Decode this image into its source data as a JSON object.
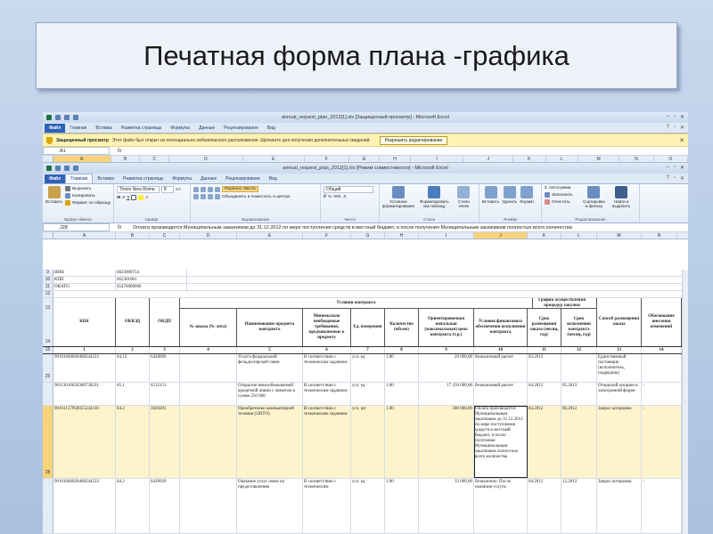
{
  "slide": {
    "title": "Печатная форма плана -графика"
  },
  "win1": {
    "title": "annual_request_plan_2012[1].xls [Защищенный просмотр] - Microsoft Excel",
    "tabs": [
      "Файл",
      "Главная",
      "Вставка",
      "Разметка страницы",
      "Формулы",
      "Данные",
      "Рецензирование",
      "Вид"
    ],
    "security": {
      "title": "Защищенный просмотр",
      "text": "Этот файл был открыт из потенциально небезопасного расположения. Щелкните для получения дополнительных сведений.",
      "button": "Разрешить редактирование"
    },
    "namebox": "A1",
    "columns": [
      "A",
      "B",
      "C",
      "D",
      "E",
      "F",
      "G",
      "H",
      "I",
      "J",
      "K",
      "L",
      "M",
      "N",
      "O"
    ]
  },
  "win2": {
    "title": "annual_request_plan_2012[1].xls [Режим совместимости] - Microsoft Excel",
    "tabs": [
      "Файл",
      "Главная",
      "Вставка",
      "Разметка страницы",
      "Формулы",
      "Данные",
      "Рецензирование",
      "Вид"
    ],
    "ribbon": {
      "paste": "Вставить",
      "cut": "Вырезать",
      "copy": "Копировать",
      "format_painter": "Формат по образцу",
      "clipboard_group": "Буфер обмена",
      "font_name": "Times New Roma",
      "font_size": "8",
      "font_group": "Шрифт",
      "wrap": "Перенос текста",
      "merge": "Объединить и поместить в центре",
      "align_group": "Выравнивание",
      "number_format": "Общий",
      "number_group": "Число",
      "cond_format": "Условное форматирование",
      "table_format": "Форматировать как таблицу",
      "cell_styles": "Стили ячеек",
      "styles_group": "Стили",
      "insert": "Вставить",
      "delete": "Удалить",
      "format": "Формат",
      "cells_group": "Ячейки",
      "autosum": "Автосумма",
      "fill": "Заполнить",
      "clear": "Очистить",
      "sort": "Сортировка и фильтр",
      "find": "Найти и выделить",
      "edit_group": "Редактирование"
    },
    "namebox": "J28",
    "formula": "Оплата производится Муниципальным заказчиком до 31.12.2012 по мере поступления средств в местный бюджет, и после получения Муниципальным заказчиком полностью всего количества",
    "columns": [
      "A",
      "B",
      "C",
      "D",
      "E",
      "F",
      "G",
      "H",
      "I",
      "J",
      "K",
      "L",
      "M",
      "N"
    ]
  },
  "info_rows": [
    {
      "rn": "9",
      "label": "ИНН",
      "value": "6623000754"
    },
    {
      "rn": "10",
      "label": "КПП",
      "value": "662301001"
    },
    {
      "rn": "11",
      "label": "ОКАТО",
      "value": "65476000000"
    }
  ],
  "header": {
    "contract_group": "Условия контракта",
    "schedule_group": "График осуществления процедур закупки",
    "kbk": "КБК",
    "okved": "ОКВЭД",
    "okdp": "ОКДП",
    "order_no": "№ заказа (№ лота)",
    "subject": "Наименование предмета контракта",
    "requirements": "Минимально необходимые требования, предъявляемые к предмету",
    "unit": "Ед. измерения",
    "quantity": "Количество (объем)",
    "price": "Ориентировочная начальная (максимальная) цена контракта (т.р.)",
    "payment": "Условия финансового обеспечения исполнения контракта",
    "placement_date": "Срок размещения заказа (месяц, год)",
    "exec_date": "Срок исполнения контракта (месяц, год)",
    "method": "Способ размещения заказа",
    "justification": "Обоснование внесения изменений",
    "rownums": {
      "r13": "13",
      "r14": "14",
      "r15": "15",
      "r12": "12"
    },
    "numbers": [
      "1",
      "2",
      "3",
      "4",
      "5",
      "6",
      "7",
      "8",
      "9",
      "10",
      "11",
      "12",
      "13",
      "14"
    ]
  },
  "data_rows": [
    {
      "rn": "26",
      "kbk": "90101040020400244223",
      "okved": "64.12",
      "okdp": "6420090",
      "subject": "Услуги федеральной фельдъегерской связи",
      "req": "В соответствии с техническим заданием",
      "unit": "усл. ед",
      "qty": "1.00",
      "price": "20 000,00",
      "pay": "безналичный расчет",
      "pdate": "03.2012",
      "edate": "",
      "method": "Единственный поставщик (исполнитель, подрядчик)",
      "just": ""
    },
    {
      "rn": "27",
      "kbk": "90113010650300730231",
      "okved": "65.1",
      "okdp": "6512151",
      "subject": "Открытие невозобновляемой кредитной линии с лимитом в сумме 250 000",
      "req": "В соответствии с техническим заданием",
      "unit": "усл. ед",
      "qty": "1.00",
      "price": "17 250 000,00",
      "pay": "безналичный расчет",
      "pdate": "04.2012",
      "edate": "05.2013",
      "method": "Открытый аукцион в электронной форме",
      "just": "-"
    },
    {
      "rn": "28",
      "kbk": "90101137950025242310",
      "okved": "64.2",
      "okdp": "3020201",
      "subject": "Приобретение компьютерной техники (ОПТО)",
      "req": "В соответствии с техническим заданием",
      "unit": "усл. шт",
      "qty": "1.00",
      "price": "300 000,00",
      "pay": "Оплата производится Муниципальным заказчиком до 31.12.2012 по мере поступления средств в местный бюджет, и после получения Муниципальным заказчиком полностью всего количества",
      "pdate": "04.2012",
      "edate": "06.2012",
      "method": "Запрос котировок",
      "just": "-"
    },
    {
      "rn": "",
      "kbk": "90101040020400244223",
      "okved": "64.2",
      "okdp": "6420020",
      "subject": "Оказание услуг связи по предоставлению",
      "req": "В соответствии с техническим",
      "unit": "усл. ед",
      "qty": "1.00",
      "price": "33 600,00",
      "pay": "безналично. После оказания услуги.",
      "pdate": "04.2012",
      "edate": "12.2012",
      "method": "Запрос котировок",
      "just": "-"
    }
  ]
}
